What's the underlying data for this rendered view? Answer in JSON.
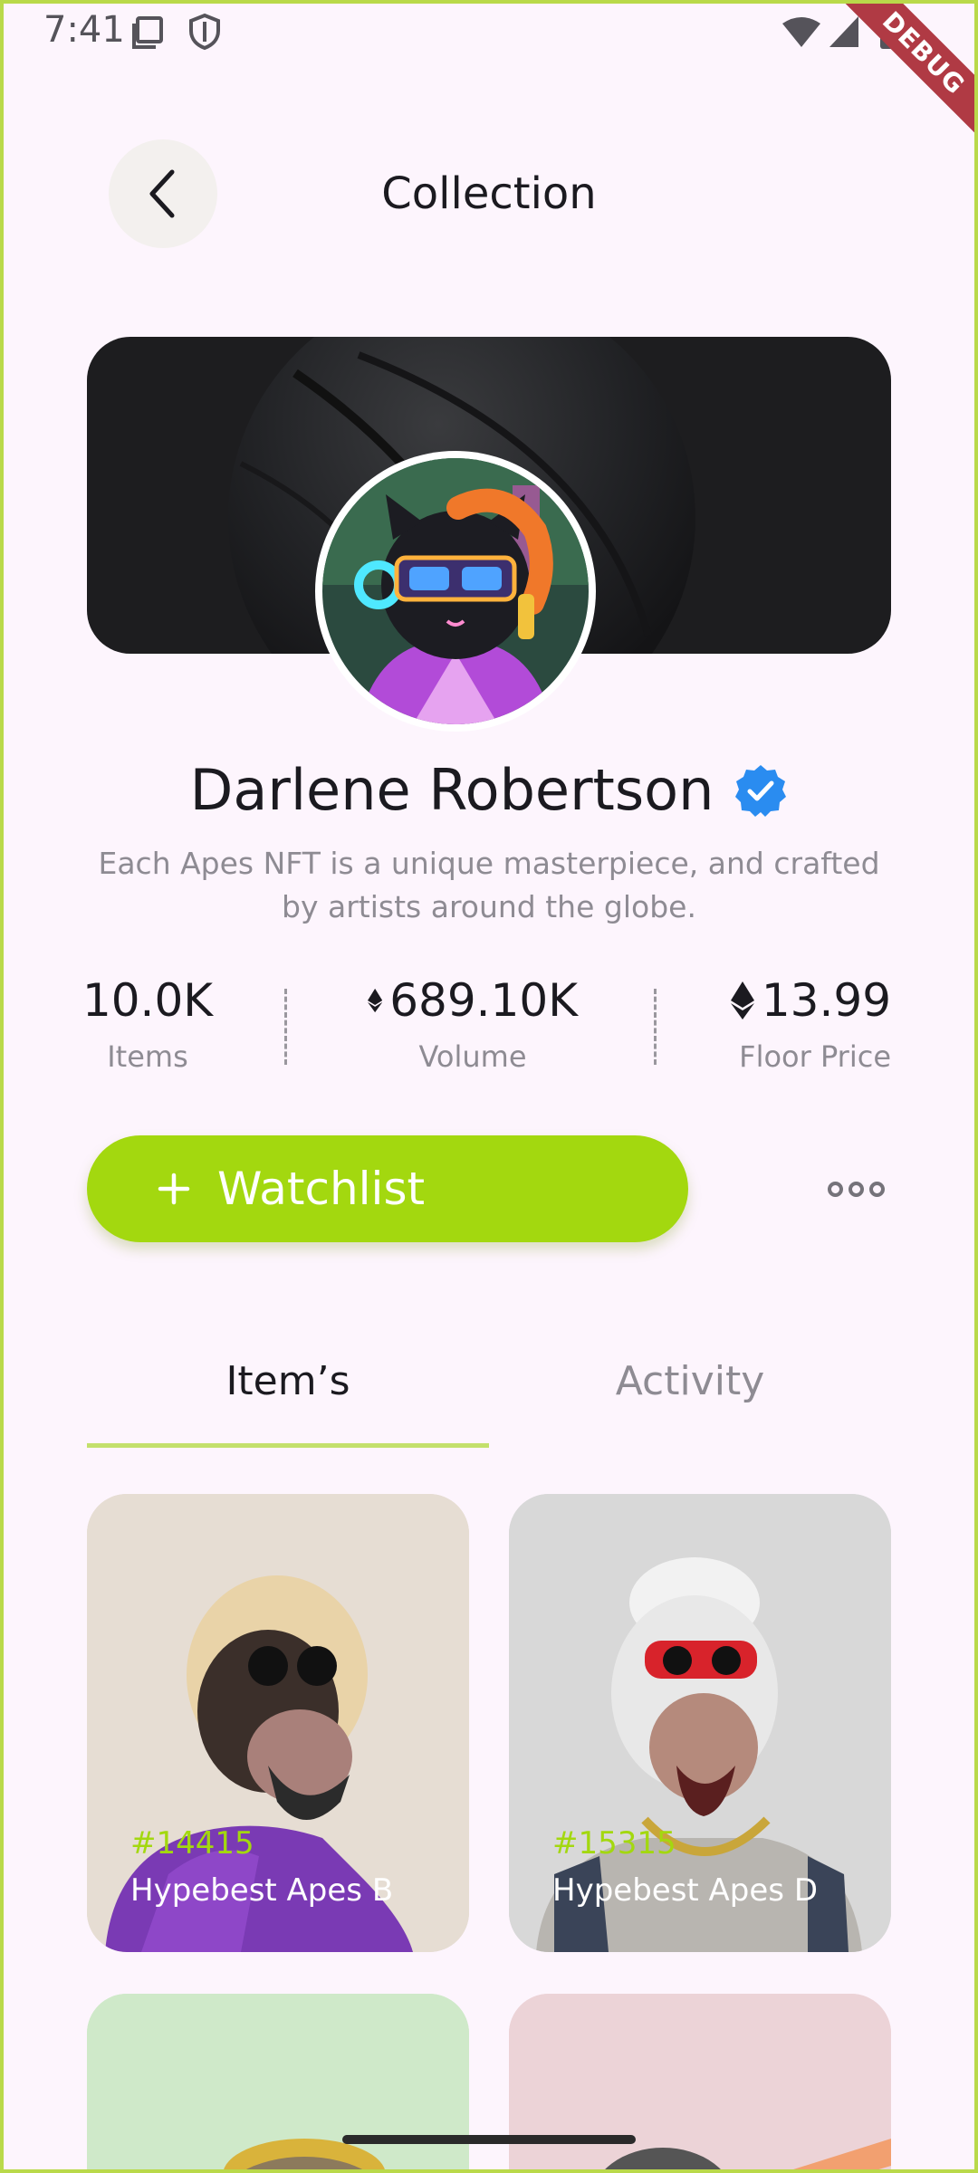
{
  "status_bar": {
    "time": "7:41",
    "debug_label": "DEBUG"
  },
  "header": {
    "title": "Collection"
  },
  "profile": {
    "name": "Darlene Robertson",
    "description": "Each Apes NFT is a unique masterpiece, and crafted by artists around the globe."
  },
  "stats": [
    {
      "value": "10.0K",
      "label": "Items",
      "icon": ""
    },
    {
      "value": "689.10K",
      "label": "Volume",
      "icon": "ethereum-icon"
    },
    {
      "value": "13.99",
      "label": "Floor Price",
      "icon": "ethereum-icon"
    }
  ],
  "actions": {
    "watchlist_label": "Watchlist",
    "watchlist_icon": "plus-icon",
    "more_icon": "more-icon"
  },
  "tabs": [
    {
      "label": "Item’s",
      "active": true
    },
    {
      "label": "Activity",
      "active": false
    }
  ],
  "items": [
    {
      "id": "#14415",
      "name": "Hypebest Apes B"
    },
    {
      "id": "#15315",
      "name": "Hypebest Apes D"
    }
  ],
  "colors": {
    "accent": "#a3d80f",
    "background": "#fdf5fd",
    "verified": "#2a8cf0"
  }
}
